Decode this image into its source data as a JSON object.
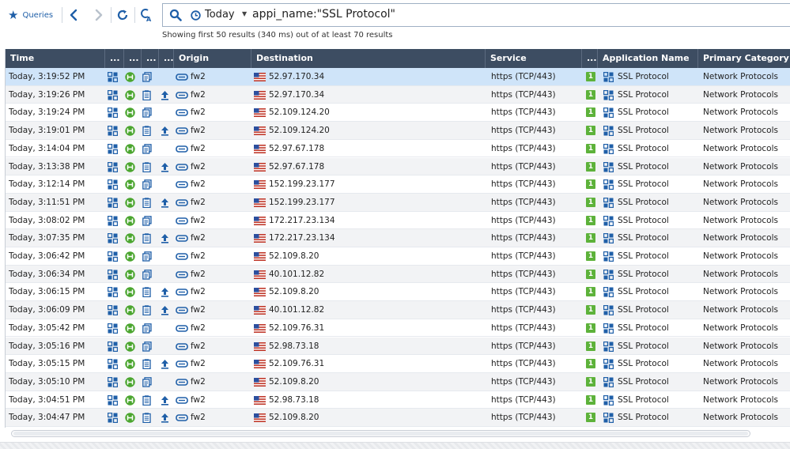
{
  "toolbar": {
    "queries_label": "Queries",
    "icons": [
      "star-icon",
      "back-arrow-icon",
      "forward-arrow-icon",
      "refresh-icon",
      "clear-search-icon"
    ]
  },
  "search": {
    "time_label": "Today",
    "query": "appi_name:\"SSL Protocol\""
  },
  "results_summary": "Showing first 50 results (340 ms) out of at least 70 results",
  "columns": {
    "time": "Time",
    "c1": "...",
    "c2": "...",
    "c3": "...",
    "c4": "...",
    "origin": "Origin",
    "destination": "Destination",
    "service": "Service",
    "c5": "...",
    "application_name": "Application Name",
    "primary_category": "Primary Category"
  },
  "colors": {
    "header_bg": "#3d4d62",
    "selected_row": "#cfe4f9",
    "accent_blue": "#1f5fa8",
    "green": "#4aa52e",
    "badge_green": "#5db23a"
  },
  "rows": [
    {
      "time": "Today, 3:19:52 PM",
      "upload": false,
      "origin": "fw2",
      "destination": "52.97.170.34",
      "service": "https (TCP/443)",
      "badge": "1",
      "application": "SSL Protocol",
      "category": "Network Protocols"
    },
    {
      "time": "Today, 3:19:26 PM",
      "upload": true,
      "origin": "fw2",
      "destination": "52.97.170.34",
      "service": "https (TCP/443)",
      "badge": "1",
      "application": "SSL Protocol",
      "category": "Network Protocols"
    },
    {
      "time": "Today, 3:19:24 PM",
      "upload": false,
      "origin": "fw2",
      "destination": "52.109.124.20",
      "service": "https (TCP/443)",
      "badge": "1",
      "application": "SSL Protocol",
      "category": "Network Protocols"
    },
    {
      "time": "Today, 3:19:01 PM",
      "upload": true,
      "origin": "fw2",
      "destination": "52.109.124.20",
      "service": "https (TCP/443)",
      "badge": "1",
      "application": "SSL Protocol",
      "category": "Network Protocols"
    },
    {
      "time": "Today, 3:14:04 PM",
      "upload": false,
      "origin": "fw2",
      "destination": "52.97.67.178",
      "service": "https (TCP/443)",
      "badge": "1",
      "application": "SSL Protocol",
      "category": "Network Protocols"
    },
    {
      "time": "Today, 3:13:38 PM",
      "upload": true,
      "origin": "fw2",
      "destination": "52.97.67.178",
      "service": "https (TCP/443)",
      "badge": "1",
      "application": "SSL Protocol",
      "category": "Network Protocols"
    },
    {
      "time": "Today, 3:12:14 PM",
      "upload": false,
      "origin": "fw2",
      "destination": "152.199.23.177",
      "service": "https (TCP/443)",
      "badge": "1",
      "application": "SSL Protocol",
      "category": "Network Protocols"
    },
    {
      "time": "Today, 3:11:51 PM",
      "upload": true,
      "origin": "fw2",
      "destination": "152.199.23.177",
      "service": "https (TCP/443)",
      "badge": "1",
      "application": "SSL Protocol",
      "category": "Network Protocols"
    },
    {
      "time": "Today, 3:08:02 PM",
      "upload": false,
      "origin": "fw2",
      "destination": "172.217.23.134",
      "service": "https (TCP/443)",
      "badge": "1",
      "application": "SSL Protocol",
      "category": "Network Protocols"
    },
    {
      "time": "Today, 3:07:35 PM",
      "upload": true,
      "origin": "fw2",
      "destination": "172.217.23.134",
      "service": "https (TCP/443)",
      "badge": "1",
      "application": "SSL Protocol",
      "category": "Network Protocols"
    },
    {
      "time": "Today, 3:06:42 PM",
      "upload": false,
      "origin": "fw2",
      "destination": "52.109.8.20",
      "service": "https (TCP/443)",
      "badge": "1",
      "application": "SSL Protocol",
      "category": "Network Protocols"
    },
    {
      "time": "Today, 3:06:34 PM",
      "upload": false,
      "origin": "fw2",
      "destination": "40.101.12.82",
      "service": "https (TCP/443)",
      "badge": "1",
      "application": "SSL Protocol",
      "category": "Network Protocols"
    },
    {
      "time": "Today, 3:06:15 PM",
      "upload": true,
      "origin": "fw2",
      "destination": "52.109.8.20",
      "service": "https (TCP/443)",
      "badge": "1",
      "application": "SSL Protocol",
      "category": "Network Protocols"
    },
    {
      "time": "Today, 3:06:09 PM",
      "upload": true,
      "origin": "fw2",
      "destination": "40.101.12.82",
      "service": "https (TCP/443)",
      "badge": "1",
      "application": "SSL Protocol",
      "category": "Network Protocols"
    },
    {
      "time": "Today, 3:05:42 PM",
      "upload": false,
      "origin": "fw2",
      "destination": "52.109.76.31",
      "service": "https (TCP/443)",
      "badge": "1",
      "application": "SSL Protocol",
      "category": "Network Protocols"
    },
    {
      "time": "Today, 3:05:16 PM",
      "upload": false,
      "origin": "fw2",
      "destination": "52.98.73.18",
      "service": "https (TCP/443)",
      "badge": "1",
      "application": "SSL Protocol",
      "category": "Network Protocols"
    },
    {
      "time": "Today, 3:05:15 PM",
      "upload": true,
      "origin": "fw2",
      "destination": "52.109.76.31",
      "service": "https (TCP/443)",
      "badge": "1",
      "application": "SSL Protocol",
      "category": "Network Protocols"
    },
    {
      "time": "Today, 3:05:10 PM",
      "upload": false,
      "origin": "fw2",
      "destination": "52.109.8.20",
      "service": "https (TCP/443)",
      "badge": "1",
      "application": "SSL Protocol",
      "category": "Network Protocols"
    },
    {
      "time": "Today, 3:04:51 PM",
      "upload": true,
      "origin": "fw2",
      "destination": "52.98.73.18",
      "service": "https (TCP/443)",
      "badge": "1",
      "application": "SSL Protocol",
      "category": "Network Protocols"
    },
    {
      "time": "Today, 3:04:47 PM",
      "upload": true,
      "origin": "fw2",
      "destination": "52.109.8.20",
      "service": "https (TCP/443)",
      "badge": "1",
      "application": "SSL Protocol",
      "category": "Network Protocols"
    }
  ]
}
